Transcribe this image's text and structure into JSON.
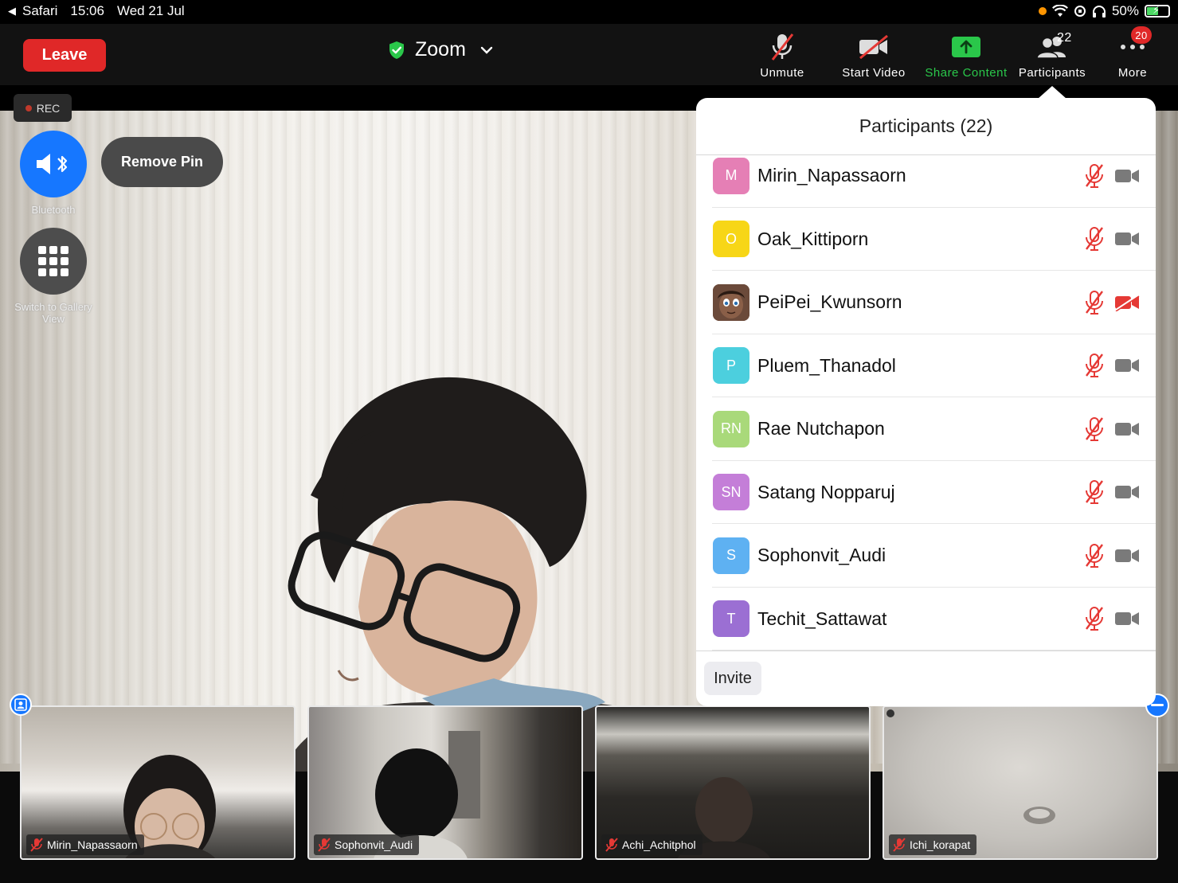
{
  "status_bar": {
    "back_app": "Safari",
    "time": "15:06",
    "date": "Wed 21 Jul",
    "battery": "50%"
  },
  "toolbar": {
    "leave_label": "Leave",
    "meeting_title": "Zoom",
    "buttons": {
      "unmute": "Unmute",
      "start_video": "Start Video",
      "share_content": "Share Content",
      "participants": "Participants",
      "participants_count": "22",
      "more": "More",
      "more_badge": "20"
    }
  },
  "main_video": {
    "rec_label": "REC",
    "bluetooth_label": "Bluetooth",
    "gallery_label": "Switch to Gallery View",
    "remove_pin_label": "Remove Pin"
  },
  "participants_panel": {
    "title": "Participants (22)",
    "participants": [
      {
        "initials": "M",
        "name": "Mirin_Napassaorn",
        "color": "#e57fb5",
        "video": "on"
      },
      {
        "initials": "O",
        "name": "Oak_Kittiporn",
        "color": "#f7d617",
        "video": "on"
      },
      {
        "initials": "",
        "name": "PeiPei_Kwunsorn",
        "color": "#7a5a48",
        "video": "off"
      },
      {
        "initials": "P",
        "name": "Pluem_Thanadol",
        "color": "#4ccfde",
        "video": "on"
      },
      {
        "initials": "RN",
        "name": "Rae Nutchapon",
        "color": "#a9d97a",
        "video": "on"
      },
      {
        "initials": "SN",
        "name": "Satang Nopparuj",
        "color": "#c47ed8",
        "video": "on"
      },
      {
        "initials": "S",
        "name": "Sophonvit_Audi",
        "color": "#5eb1f2",
        "video": "on"
      },
      {
        "initials": "T",
        "name": "Techit_Sattawat",
        "color": "#9b6fd3",
        "video": "on"
      }
    ],
    "invite_label": "Invite"
  },
  "thumbnails": [
    {
      "name": "Mirin_Napassaorn"
    },
    {
      "name": "Sophonvit_Audi"
    },
    {
      "name": "Achi_Achitphol"
    },
    {
      "name": "Ichi_korapat"
    }
  ],
  "colors": {
    "leave": "#e02828",
    "share_green": "#2ac74a",
    "accent_blue": "#1677ff",
    "muted_red": "#e53935"
  }
}
